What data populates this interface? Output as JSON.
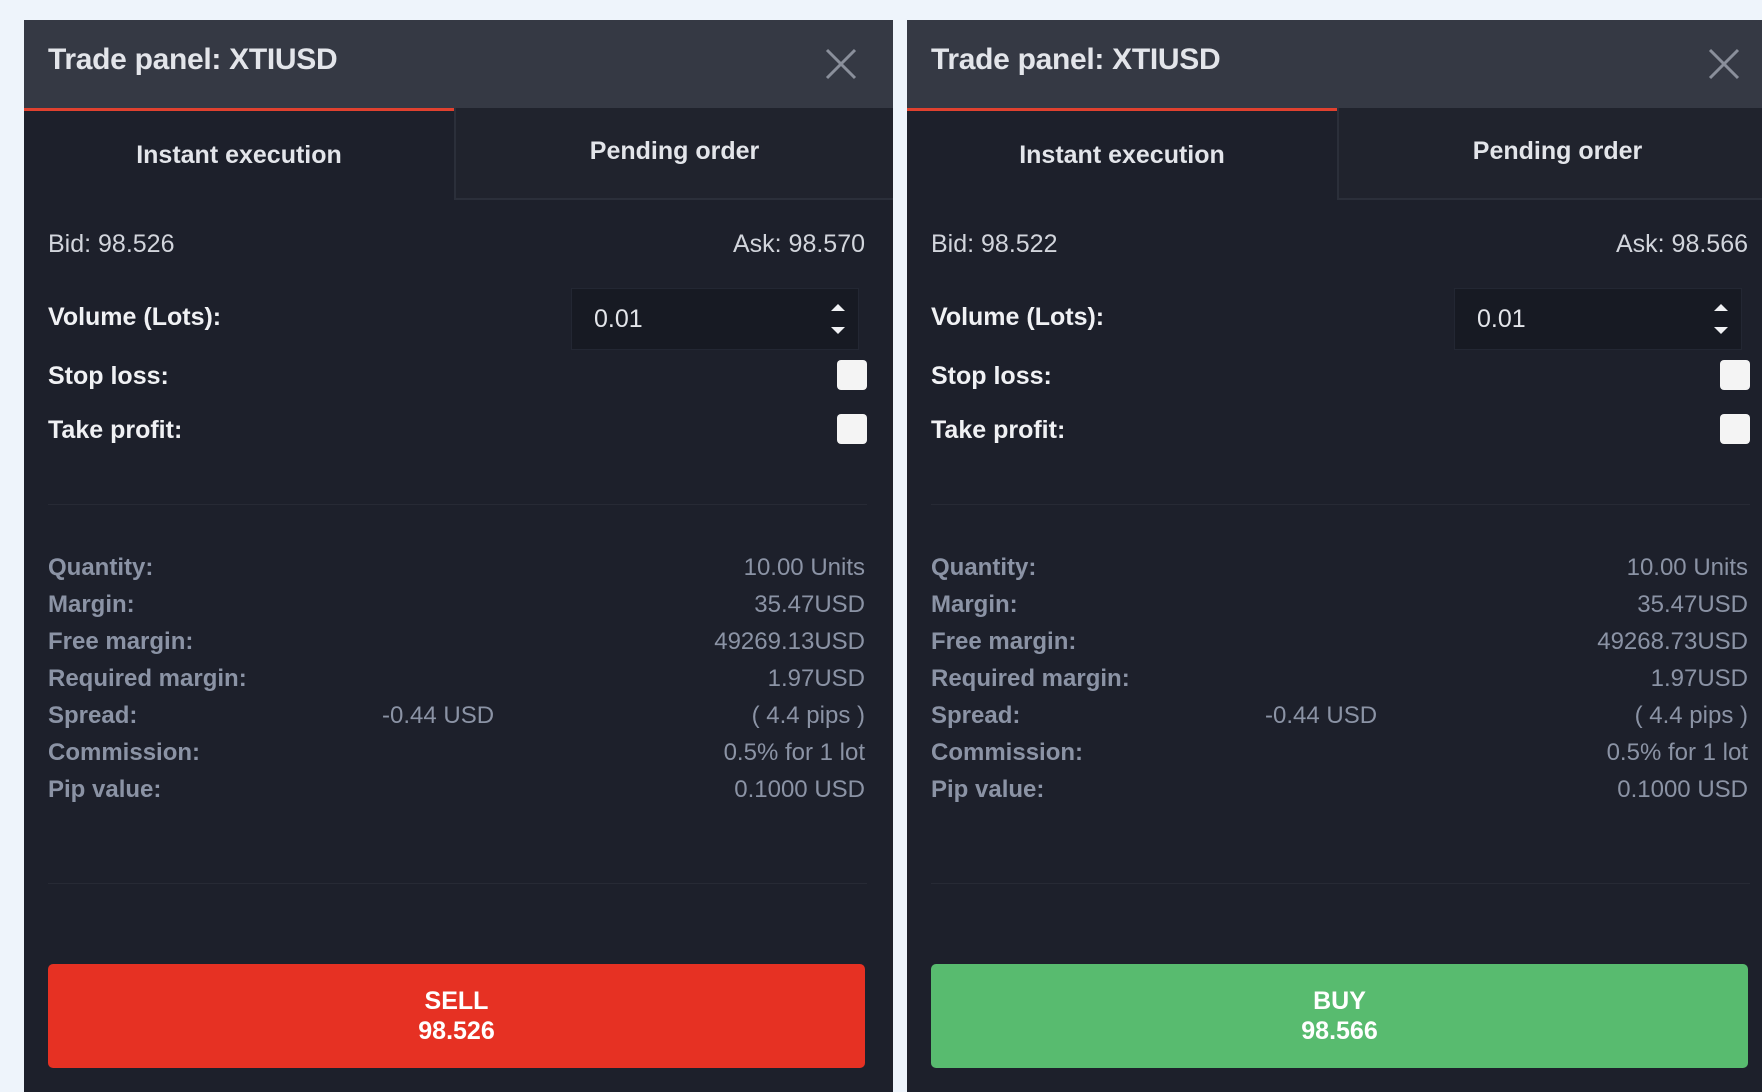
{
  "colors": {
    "page_background": "#eef4fb",
    "panel_background": "#1d202b",
    "titlebar": "#353944",
    "active_tab_indicator": "#e0412f",
    "sell_button": "#e63123",
    "buy_button": "#58bb6f",
    "muted_text": "#8b93a5"
  },
  "icons": {
    "close": "close-icon",
    "spin_up": "chevron-up-icon",
    "spin_down": "chevron-down-icon"
  },
  "panels": [
    {
      "title": "Trade panel: XTIUSD",
      "tabs": [
        {
          "label": "Instant execution",
          "active": true
        },
        {
          "label": "Pending order",
          "active": false
        }
      ],
      "bid": "Bid: 98.526",
      "ask": "Ask: 98.570",
      "volume_label": "Volume (Lots):",
      "volume_value": "0.01",
      "stop_loss_label": "Stop loss:",
      "stop_loss_checked": false,
      "take_profit_label": "Take profit:",
      "take_profit_checked": false,
      "info": {
        "quantity_label": "Quantity:",
        "quantity": "10.00 Units",
        "margin_label": "Margin:",
        "margin": "35.47USD",
        "free_margin_label": "Free margin:",
        "free_margin": "49269.13USD",
        "required_margin_label": "Required margin:",
        "required_margin": "1.97USD",
        "spread_label": "Spread:",
        "spread_usd": "-0.44 USD",
        "spread_pips": "( 4.4 pips )",
        "commission_label": "Commission:",
        "commission": "0.5% for 1 lot",
        "pip_value_label": "Pip value:",
        "pip_value": "0.1000 USD"
      },
      "action": {
        "label": "SELL",
        "price": "98.526"
      }
    },
    {
      "title": "Trade panel: XTIUSD",
      "tabs": [
        {
          "label": "Instant execution",
          "active": true
        },
        {
          "label": "Pending order",
          "active": false
        }
      ],
      "bid": "Bid: 98.522",
      "ask": "Ask: 98.566",
      "volume_label": "Volume (Lots):",
      "volume_value": "0.01",
      "stop_loss_label": "Stop loss:",
      "stop_loss_checked": false,
      "take_profit_label": "Take profit:",
      "take_profit_checked": false,
      "info": {
        "quantity_label": "Quantity:",
        "quantity": "10.00 Units",
        "margin_label": "Margin:",
        "margin": "35.47USD",
        "free_margin_label": "Free margin:",
        "free_margin": "49268.73USD",
        "required_margin_label": "Required margin:",
        "required_margin": "1.97USD",
        "spread_label": "Spread:",
        "spread_usd": "-0.44 USD",
        "spread_pips": "( 4.4 pips )",
        "commission_label": "Commission:",
        "commission": "0.5% for 1 lot",
        "pip_value_label": "Pip value:",
        "pip_value": "0.1000 USD"
      },
      "action": {
        "label": "BUY",
        "price": "98.566"
      }
    }
  ]
}
